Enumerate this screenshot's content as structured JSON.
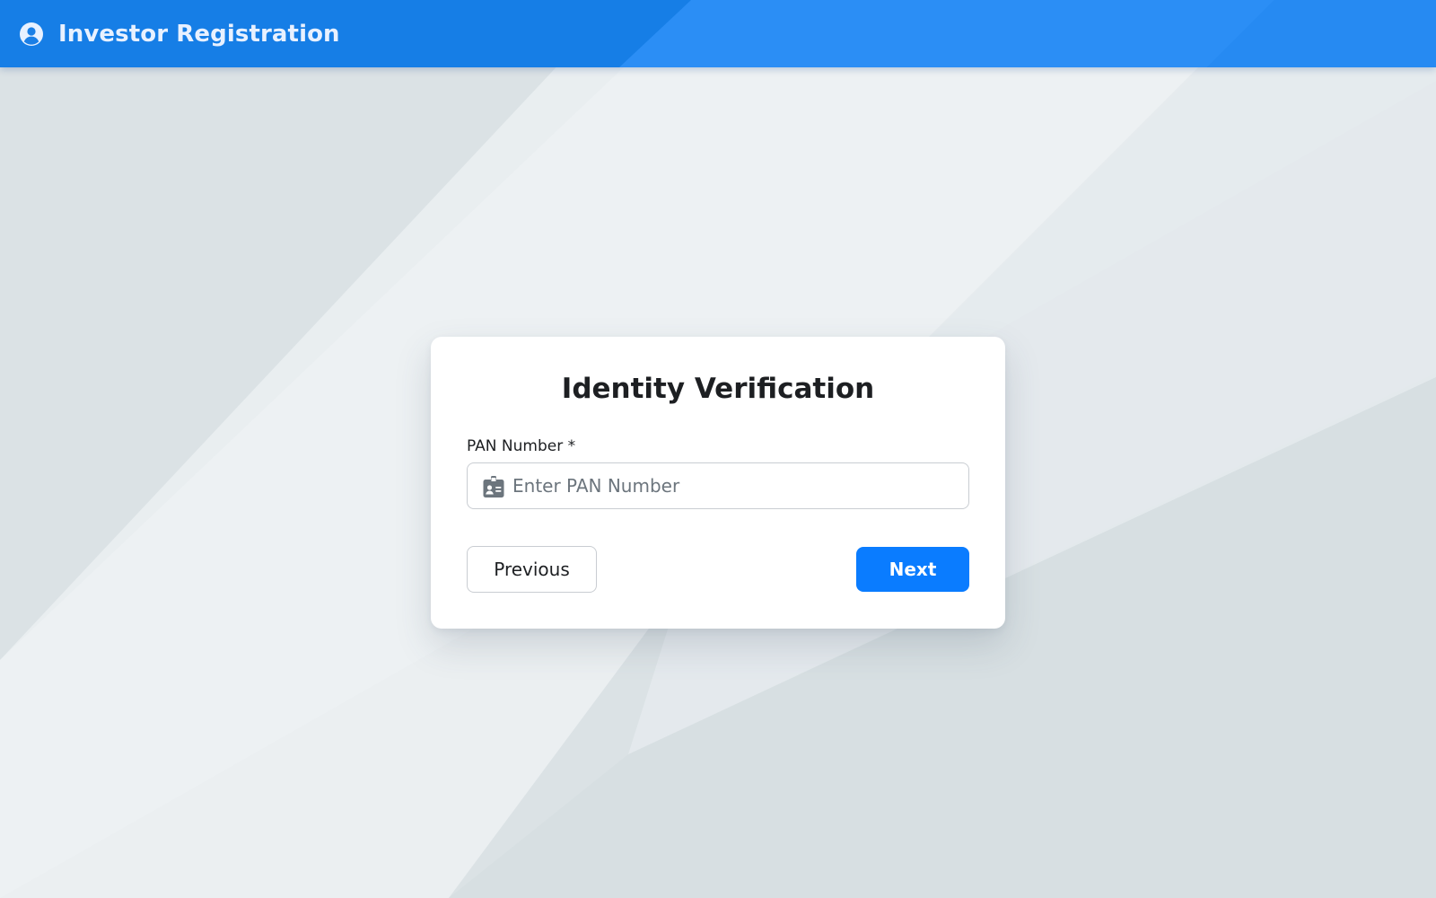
{
  "header": {
    "title": "Investor Registration",
    "icon": "user-circle-icon",
    "color": "#1a7fe6"
  },
  "form": {
    "title": "Identity Verification",
    "pan_field": {
      "label": "PAN Number *",
      "placeholder": "Enter PAN Number",
      "value": "",
      "icon": "id-badge-icon"
    },
    "buttons": {
      "previous_label": "Previous",
      "next_label": "Next"
    },
    "accent_color": "#0a7cff"
  }
}
